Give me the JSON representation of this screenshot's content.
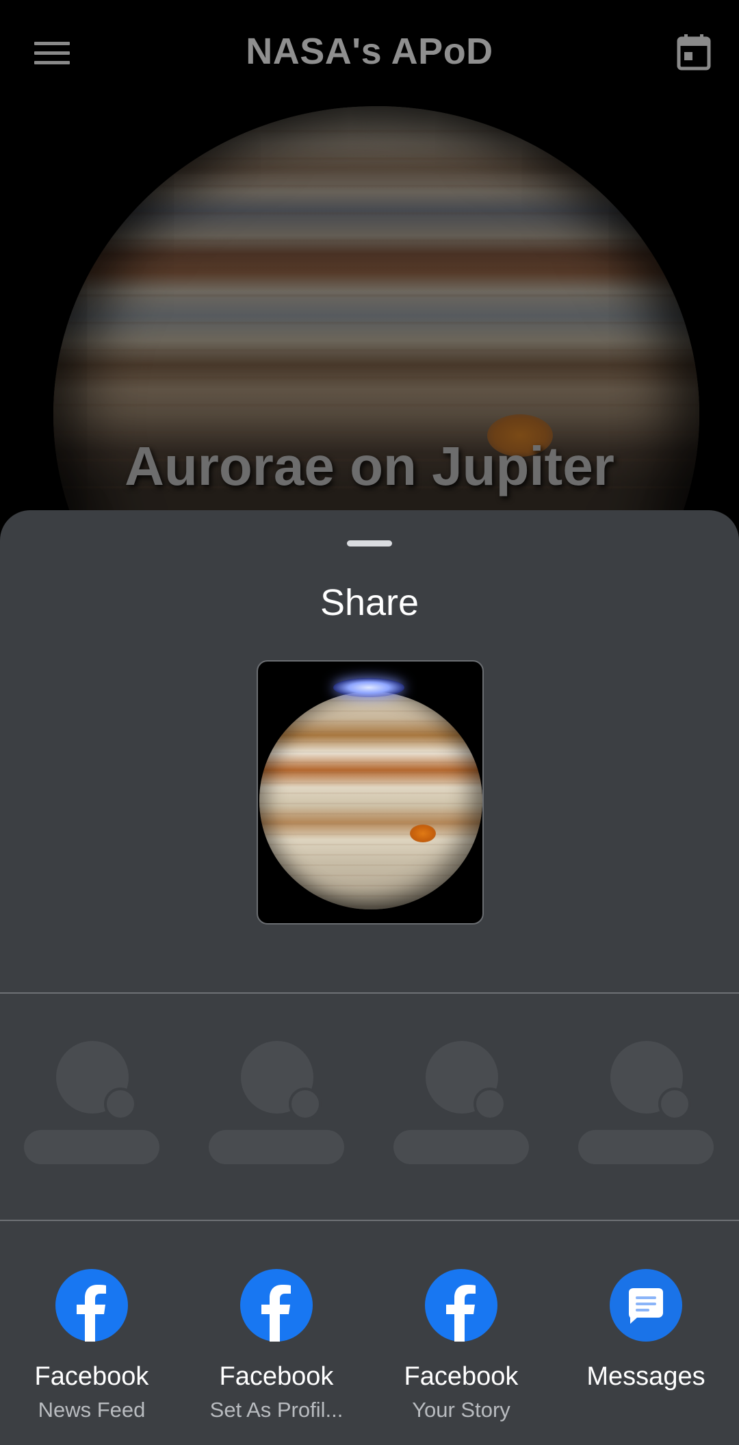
{
  "appbar": {
    "title": "NASA's APoD",
    "menu_icon": "hamburger-menu-icon",
    "calendar_icon": "calendar-icon"
  },
  "hero": {
    "title": "Aurorae on Jupiter"
  },
  "share_sheet": {
    "title": "Share",
    "apps": [
      {
        "name": "Facebook",
        "subtitle": "News Feed",
        "icon": "facebook-icon",
        "color": "#1877f2"
      },
      {
        "name": "Facebook",
        "subtitle": "Set As Profil...",
        "icon": "facebook-icon",
        "color": "#1877f2"
      },
      {
        "name": "Facebook",
        "subtitle": "Your Story",
        "icon": "facebook-icon",
        "color": "#1877f2"
      },
      {
        "name": "Messages",
        "subtitle": "",
        "icon": "messages-icon",
        "color": "#1a73e8"
      }
    ]
  },
  "colors": {
    "sheet_background": "#3c3f43",
    "placeholder": "#494c50",
    "facebook_blue": "#1877f2",
    "messages_blue": "#1a73e8"
  }
}
